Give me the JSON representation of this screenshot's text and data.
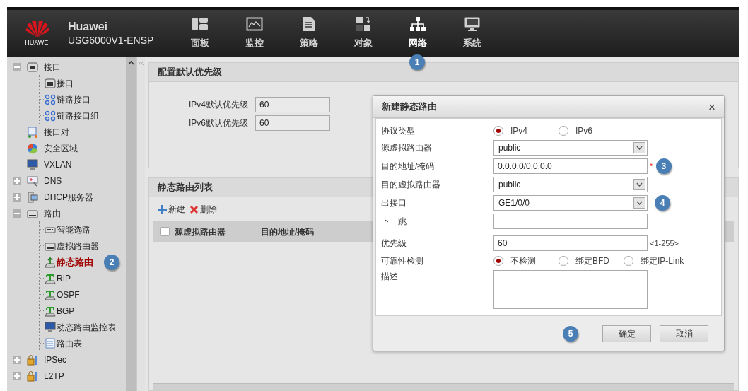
{
  "header": {
    "logo_text": "HUAWEI",
    "title": "Huawei",
    "subtitle": "USG6000V1-ENSP",
    "nav": [
      {
        "label": "面板",
        "kind": "dashboard",
        "selected": false
      },
      {
        "label": "监控",
        "kind": "monitor",
        "selected": false
      },
      {
        "label": "策略",
        "kind": "policy",
        "selected": false
      },
      {
        "label": "对象",
        "kind": "object",
        "selected": false
      },
      {
        "label": "网络",
        "kind": "network",
        "selected": true,
        "badge": "1"
      },
      {
        "label": "系统",
        "kind": "system",
        "selected": false
      }
    ]
  },
  "sidebar": {
    "tree": [
      {
        "label": "接口",
        "kind": "port",
        "expanded": true,
        "selected": false,
        "children": [
          {
            "label": "接口",
            "kind": "port",
            "selected": false
          },
          {
            "label": "链路接口",
            "kind": "link",
            "selected": false
          },
          {
            "label": "链路接口组",
            "kind": "link",
            "selected": false
          }
        ]
      },
      {
        "label": "接口对",
        "kind": "pair",
        "selected": false
      },
      {
        "label": "安全区域",
        "kind": "zone",
        "selected": false
      },
      {
        "label": "VXLAN",
        "kind": "screen",
        "selected": false
      },
      {
        "label": "DNS",
        "kind": "dns",
        "expanded": false,
        "selected": false
      },
      {
        "label": "DHCP服务器",
        "kind": "server",
        "expanded": false,
        "selected": false
      },
      {
        "label": "路由",
        "kind": "router",
        "expanded": true,
        "selected": false,
        "children": [
          {
            "label": "智能选路",
            "kind": "switch",
            "selected": false
          },
          {
            "label": "虚拟路由器",
            "kind": "router",
            "selected": false
          },
          {
            "label": "静态路由",
            "kind": "static",
            "selected": true,
            "badge": "2"
          },
          {
            "label": "RIP",
            "kind": "proto",
            "selected": false
          },
          {
            "label": "OSPF",
            "kind": "proto",
            "selected": false
          },
          {
            "label": "BGP",
            "kind": "proto",
            "selected": false
          },
          {
            "label": "动态路由监控表",
            "kind": "screen",
            "selected": false
          },
          {
            "label": "路由表",
            "kind": "table",
            "selected": false
          }
        ]
      },
      {
        "label": "IPSec",
        "kind": "lock",
        "expanded": false,
        "selected": false
      },
      {
        "label": "L2TP",
        "kind": "lock",
        "expanded": false,
        "selected": false
      }
    ]
  },
  "default_priority": {
    "title": "配置默认优先级",
    "fields": [
      {
        "label": "IPv4默认优先级",
        "value": "60"
      },
      {
        "label": "IPv6默认优先级",
        "value": "60"
      }
    ]
  },
  "route_list": {
    "title": "静态路由列表",
    "actions": [
      {
        "label": "新建",
        "kind": "add"
      },
      {
        "label": "删除",
        "kind": "delete"
      }
    ],
    "columns": [
      "源虚拟路由器",
      "目的地址/掩码"
    ],
    "select_all": {
      "checked": false
    }
  },
  "dialog": {
    "title": "新建静态路由",
    "close": "×",
    "fields": [
      {
        "label": "协议类型",
        "kind": "radio",
        "options": [
          {
            "label": "IPv4",
            "selected": true
          },
          {
            "label": "IPv6",
            "selected": false
          }
        ]
      },
      {
        "label": "源虚拟路由器",
        "kind": "select",
        "value": "public"
      },
      {
        "label": "目的地址/掩码",
        "kind": "input",
        "value": "0.0.0.0/0.0.0.0",
        "required_mark": "*",
        "badge": "3"
      },
      {
        "label": "目的虚拟路由器",
        "kind": "select",
        "value": "public"
      },
      {
        "label": "出接口",
        "kind": "select",
        "value": "GE1/0/0",
        "badge": "4"
      },
      {
        "label": "下一跳",
        "kind": "input"
      },
      {
        "label": "优先级",
        "kind": "input",
        "value": "60",
        "hint": "<1-255>"
      },
      {
        "label": "可靠性检测",
        "kind": "radio",
        "options": [
          {
            "label": "不检测",
            "selected": true
          },
          {
            "label": "绑定BFD",
            "selected": false
          },
          {
            "label": "绑定IP-Link",
            "selected": false
          }
        ]
      },
      {
        "label": "描述",
        "kind": "textarea"
      }
    ],
    "footer_badge": "5",
    "buttons": [
      "确定",
      "取消"
    ]
  }
}
